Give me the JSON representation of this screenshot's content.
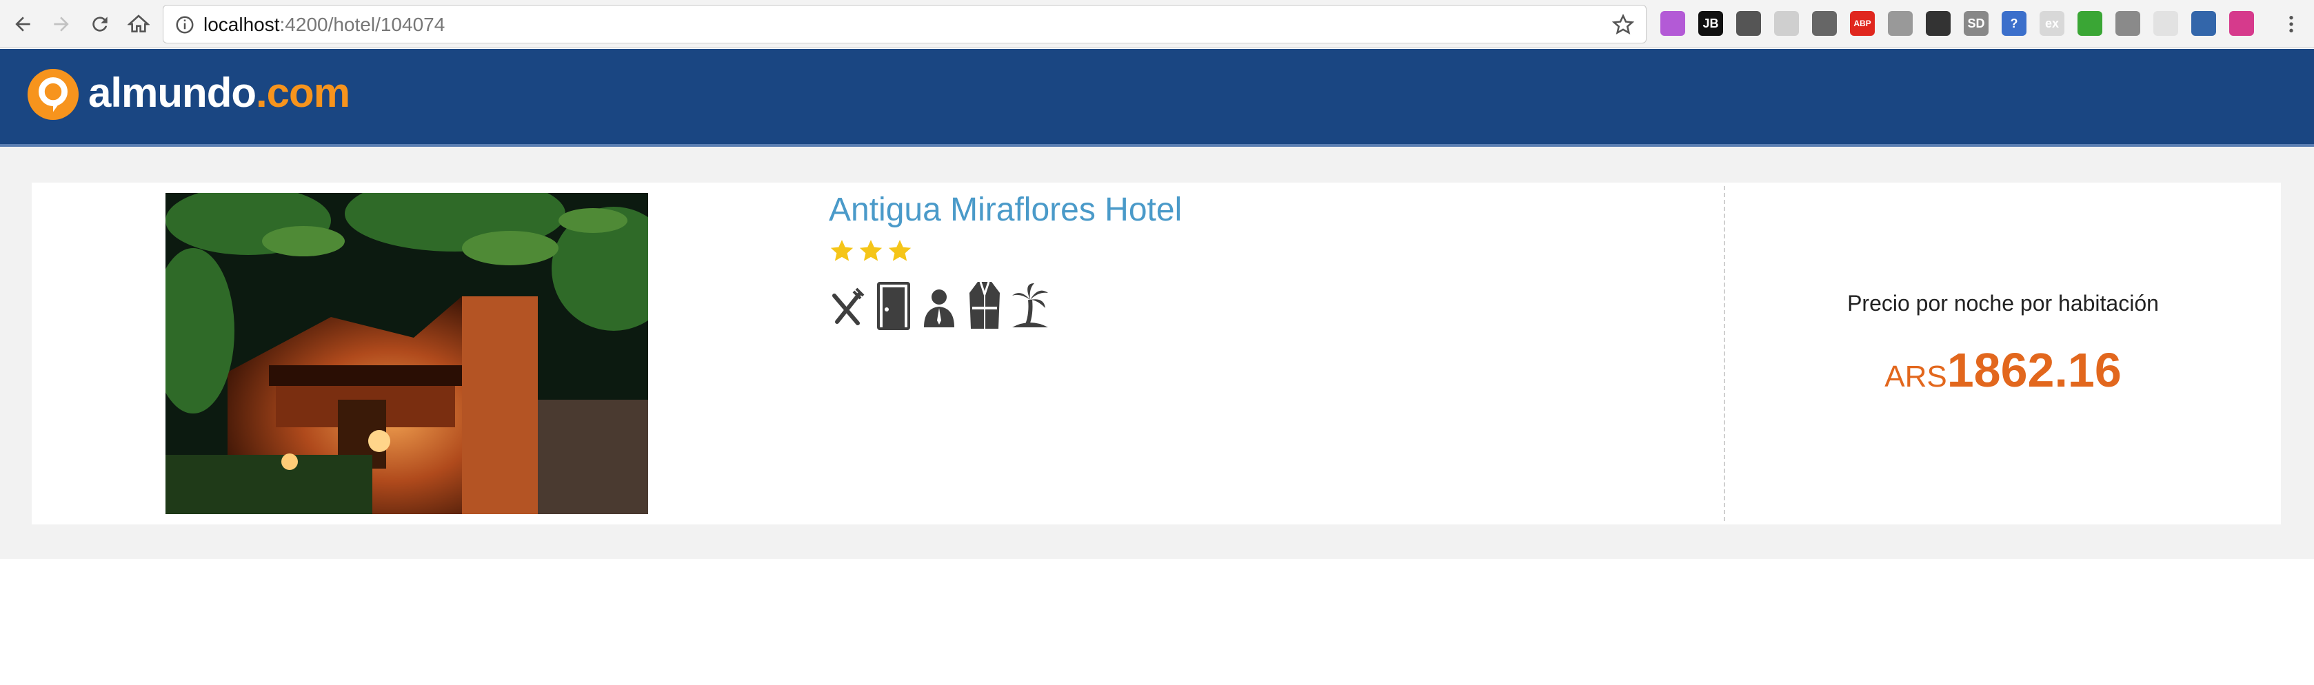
{
  "browser": {
    "url_host": "localhost",
    "url_path": ":4200/hotel/104074",
    "extensions": [
      {
        "icon": "pen-extension-icon",
        "label": "",
        "color": "#b35ad6"
      },
      {
        "icon": "jetbrains-extension-icon",
        "label": "JB",
        "color": "#111111"
      },
      {
        "icon": "sync-extension-icon",
        "label": "",
        "color": "#555555"
      },
      {
        "icon": "feather-extension-icon",
        "label": "",
        "color": "#cfcfcf"
      },
      {
        "icon": "mail-extension-icon",
        "label": "",
        "color": "#666666"
      },
      {
        "icon": "adblock-extension-icon",
        "label": "ABP",
        "color": "#e0271e"
      },
      {
        "icon": "reader-extension-icon",
        "label": "",
        "color": "#999999"
      },
      {
        "icon": "incognito-extension-icon",
        "label": "",
        "color": "#333333"
      },
      {
        "icon": "sd-extension-icon",
        "label": "SD",
        "color": "#888888"
      },
      {
        "icon": "help-extension-icon",
        "label": "?",
        "color": "#3b6fcb"
      },
      {
        "icon": "ex-extension-icon",
        "label": "ex",
        "color": "#d8d8d8"
      },
      {
        "icon": "gear-extension-icon",
        "label": "",
        "color": "#3aa635"
      },
      {
        "icon": "camera-extension-icon",
        "label": "",
        "color": "#8a8a8a"
      },
      {
        "icon": "circle-extension-icon",
        "label": "",
        "color": "#e2e2e2"
      },
      {
        "icon": "tools-extension-icon",
        "label": "",
        "color": "#3366aa"
      },
      {
        "icon": "color-wheel-extension-icon",
        "label": "",
        "color": "#d63a8c"
      }
    ]
  },
  "site": {
    "brand": "almundo",
    "brand_tld": ".com",
    "header_color": "#1a4682",
    "accent": "#f7941d"
  },
  "hotel": {
    "name": "Antigua Miraflores Hotel",
    "stars": 3,
    "amenities": [
      "restaurant-icon",
      "room-door-icon",
      "concierge-icon",
      "bathrobe-icon",
      "beach-icon"
    ],
    "price_label": "Precio por noche por habitación",
    "currency": "ARS",
    "price": "1862.16"
  }
}
